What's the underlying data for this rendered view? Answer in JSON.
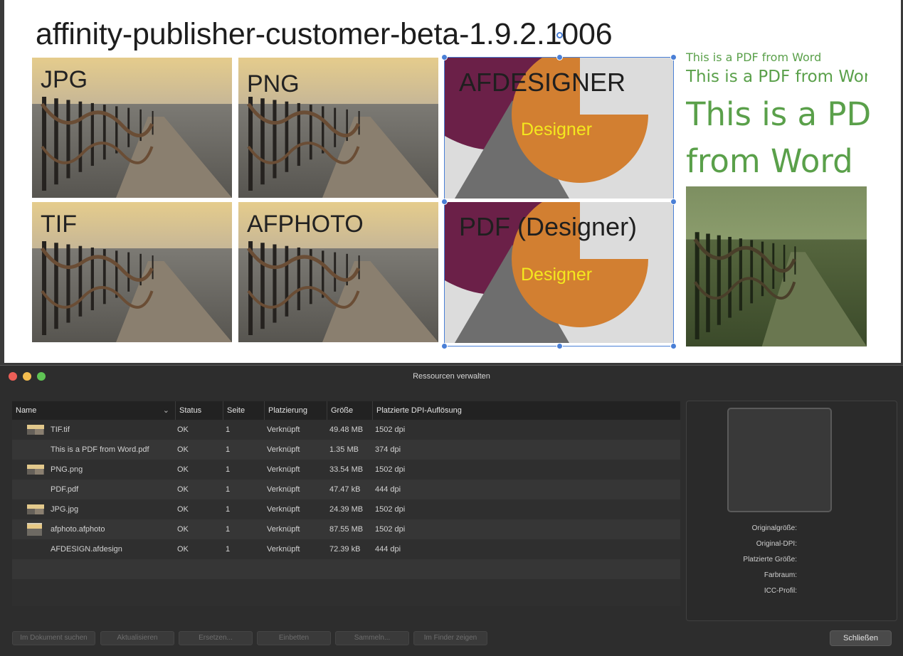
{
  "document": {
    "title": "affinity-publisher-customer-beta-1.9.2.1006",
    "tiles": {
      "jpg": "JPG",
      "png": "PNG",
      "tif": "TIF",
      "afphoto": "AFPHOTO",
      "afdesigner": "AFDESIGNER",
      "pdf_designer": "PDF (Designer)",
      "designer_word": "Designer"
    },
    "pdf_text": {
      "line_small": "This is a PDF from Word",
      "line_medium": "This is a PDF from Wor",
      "line_large_1": "This is a PD",
      "line_large_2": "from Word"
    },
    "colors": {
      "pdf_green": "#5aa04a",
      "designer_orange": "#d27f31",
      "designer_purple": "#6b2048",
      "designer_gray": "#6e6e6e",
      "selection_blue": "#4a7fd6"
    }
  },
  "dialog": {
    "title": "Ressourcen verwalten",
    "columns": [
      "Name",
      "Status",
      "Seite",
      "Platzierung",
      "Größe",
      "Platzierte DPI-Auflösung"
    ],
    "rows": [
      {
        "thumb": "pier-thumbnail",
        "name": "TIF.tif",
        "status": "OK",
        "page": "1",
        "placement": "Verknüpft",
        "size": "49.48 MB",
        "dpi": "1502 dpi"
      },
      {
        "thumb": "",
        "name": "This is a PDF from Word.pdf",
        "status": "OK",
        "page": "1",
        "placement": "Verknüpft",
        "size": "1.35 MB",
        "dpi": "374 dpi"
      },
      {
        "thumb": "pier-thumbnail",
        "name": "PNG.png",
        "status": "OK",
        "page": "1",
        "placement": "Verknüpft",
        "size": "33.54 MB",
        "dpi": "1502 dpi"
      },
      {
        "thumb": "",
        "name": "PDF.pdf",
        "status": "OK",
        "page": "1",
        "placement": "Verknüpft",
        "size": "47.47 kB",
        "dpi": "444 dpi"
      },
      {
        "thumb": "pier-thumbnail",
        "name": "JPG.jpg",
        "status": "OK",
        "page": "1",
        "placement": "Verknüpft",
        "size": "24.39 MB",
        "dpi": "1502 dpi"
      },
      {
        "thumb": "afphoto-thumbnail",
        "name": "afphoto.afphoto",
        "status": "OK",
        "page": "1",
        "placement": "Verknüpft",
        "size": "87.55 MB",
        "dpi": "1502 dpi"
      },
      {
        "thumb": "",
        "name": "AFDESIGN.afdesign",
        "status": "OK",
        "page": "1",
        "placement": "Verknüpft",
        "size": "72.39 kB",
        "dpi": "444 dpi"
      }
    ],
    "info_labels": {
      "original_size": "Originalgröße:",
      "original_dpi": "Original-DPI:",
      "placed_size": "Platzierte Größe:",
      "color_space": "Farbraum:",
      "icc_profile": "ICC-Profil:"
    },
    "buttons": {
      "find_in_document": "Im Dokument suchen",
      "update": "Aktualisieren",
      "replace": "Ersetzen...",
      "embed": "Einbetten",
      "collect": "Sammeln...",
      "show_in_finder": "Im Finder zeigen",
      "close": "Schließen"
    }
  }
}
